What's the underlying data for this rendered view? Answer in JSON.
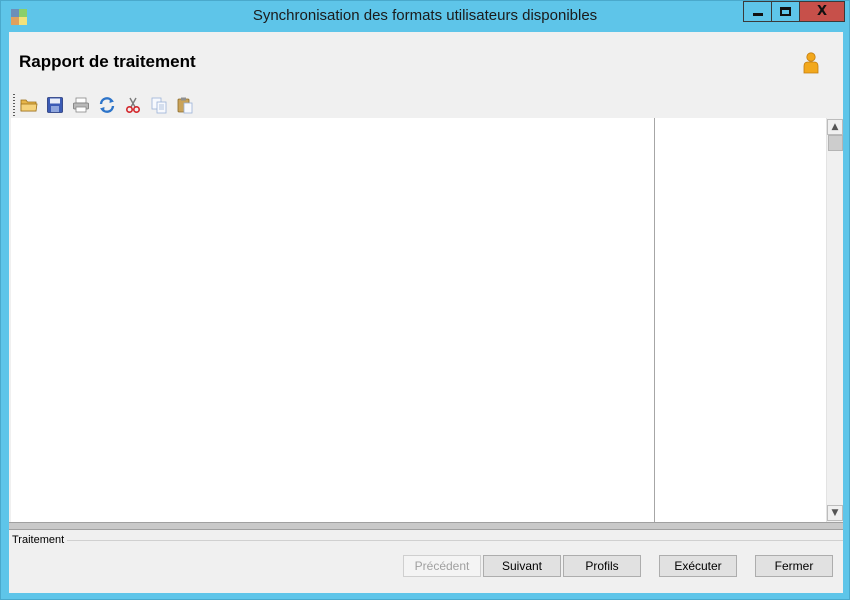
{
  "window": {
    "title": "Synchronisation des formats utilisateurs disponibles",
    "controls": {
      "close_glyph": "X"
    }
  },
  "header": {
    "title": "Rapport de traitement",
    "user_icon": "user-icon"
  },
  "toolbar": {
    "buttons": [
      {
        "icon": "open-folder-icon"
      },
      {
        "icon": "save-icon"
      },
      {
        "icon": "print-icon"
      },
      {
        "icon": "refresh-icon"
      },
      {
        "icon": "cut-icon"
      },
      {
        "icon": "copy-icon"
      },
      {
        "icon": "paste-icon"
      }
    ]
  },
  "report": {
    "content": ""
  },
  "status": {
    "group_label": "Traitement"
  },
  "footer": {
    "buttons": {
      "previous": "Précédent",
      "next": "Suivant",
      "profiles": "Profils",
      "execute": "Exécuter",
      "close": "Fermer"
    }
  },
  "colors": {
    "titlebar": "#5ec5e9",
    "close_button": "#c7504a",
    "client_bg": "#f0f0f0"
  }
}
